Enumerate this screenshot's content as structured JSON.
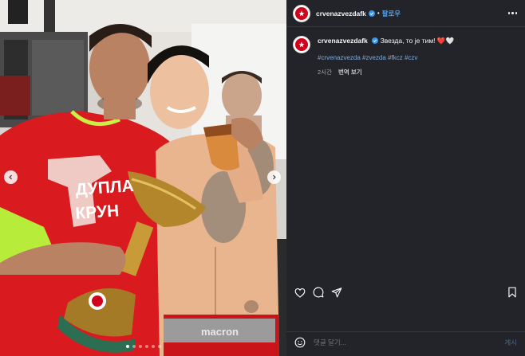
{
  "post": {
    "username": "crvenazvezdafk",
    "follow_label": "팔로우",
    "separator": "•",
    "caption_text": "Звезда, то је тим!",
    "caption_emoji": "❤️🤍",
    "hashtags": "#crvenazvezda #zvezda #fkcz #czv",
    "time_ago": "2시간",
    "translate_label": "번역 보기"
  },
  "photo": {
    "jersey_text_line1": "ДУПЛА",
    "jersey_text_line2": "КРУН",
    "shorts_brand": "macron",
    "carousel_count": 6,
    "carousel_active_index": 0
  },
  "comment": {
    "placeholder": "댓글 달기...",
    "post_label": "게시"
  },
  "icons": [
    "verified-icon",
    "more-options-icon",
    "heart-icon",
    "comment-icon",
    "share-icon",
    "bookmark-icon",
    "emoji-icon",
    "chevron-left-icon",
    "chevron-right-icon"
  ],
  "colors": {
    "panel_bg": "#232429",
    "link_blue": "#4aa3f5",
    "hashtag": "#7fa7dc",
    "brand_red": "#d0021b",
    "jersey_red": "#d91a1f"
  }
}
